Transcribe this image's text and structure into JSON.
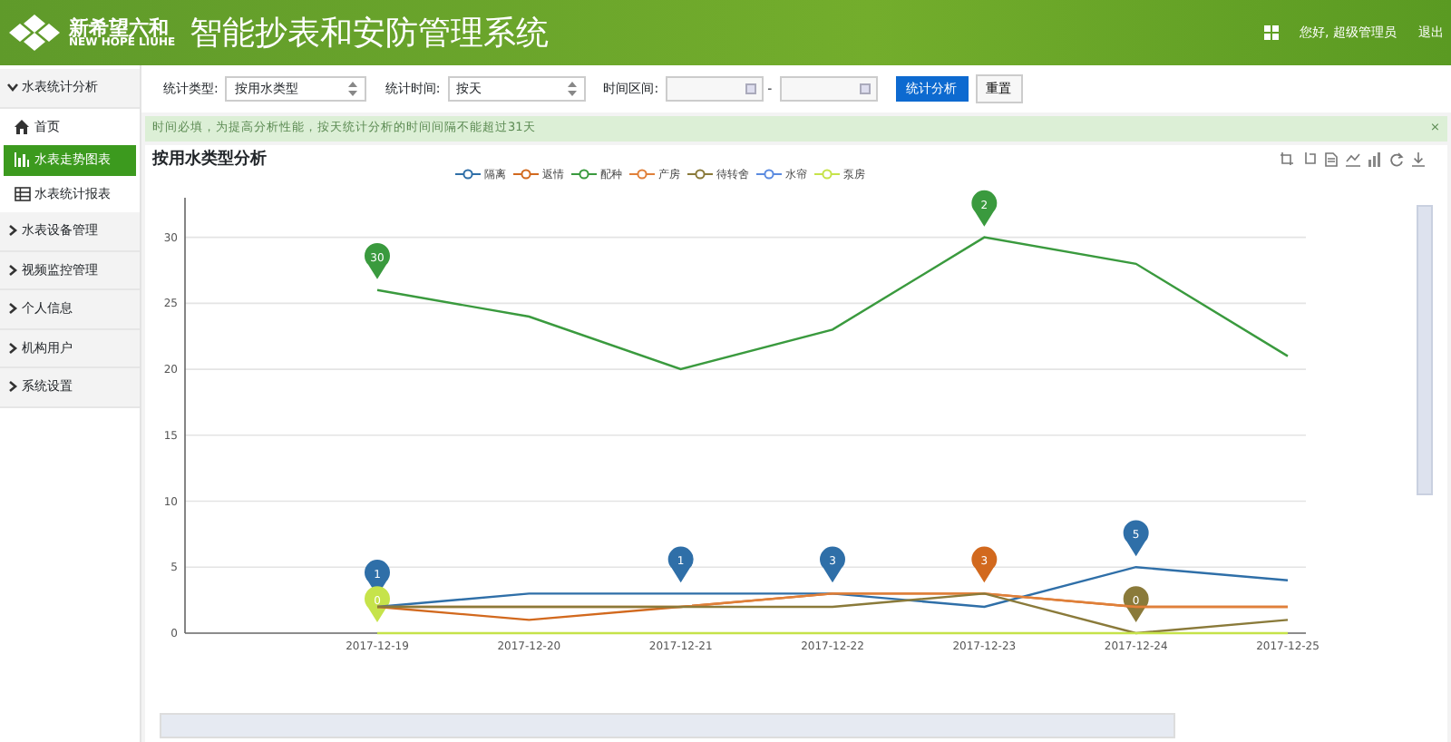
{
  "header": {
    "brand_cn": "新希望六和",
    "brand_en": "NEW HOPE LIUHE",
    "title": "智能抄表和安防管理系统",
    "greeting": "您好, 超级管理员",
    "logout": "退出"
  },
  "sidebar": {
    "items": [
      {
        "label": "水表统计分析",
        "expanded": true,
        "children": [
          {
            "label": "首页",
            "kind": "home",
            "selected": false
          },
          {
            "label": "水表走势图表",
            "kind": "chart",
            "selected": true
          },
          {
            "label": "水表统计报表",
            "kind": "table",
            "selected": false
          }
        ]
      },
      {
        "label": "水表设备管理",
        "expanded": false
      },
      {
        "label": "视频监控管理",
        "expanded": false
      },
      {
        "label": "个人信息",
        "expanded": false
      },
      {
        "label": "机构用户",
        "expanded": false
      },
      {
        "label": "系统设置",
        "expanded": false
      }
    ]
  },
  "filters": {
    "type_label": "统计类型:",
    "type_value": "按用水类型",
    "time_label": "统计时间:",
    "time_value": "按天",
    "range_label": "时间区间:",
    "range_separator": "-",
    "submit": "统计分析",
    "reset": "重置"
  },
  "alert": {
    "text": "时间必填，为提高分析性能，按天统计分析的时间间隔不能超过31天",
    "close": "×"
  },
  "chart": {
    "title": "按用水类型分析",
    "chart_data": {
      "type": "line",
      "categories": [
        "2017-12-19",
        "2017-12-20",
        "2017-12-21",
        "2017-12-22",
        "2017-12-23",
        "2017-12-24",
        "2017-12-25"
      ],
      "ylim": [
        0,
        33
      ],
      "grid": true,
      "yticks": [
        0,
        5,
        10,
        15,
        20,
        25,
        30
      ],
      "series": [
        {
          "name": "隔离",
          "color": "#2f6fa8",
          "values": [
            2,
            3,
            3,
            3,
            2,
            5,
            4
          ]
        },
        {
          "name": "返情",
          "color": "#d2691e",
          "values": [
            2,
            1,
            2,
            3,
            3,
            2,
            2
          ]
        },
        {
          "name": "配种",
          "color": "#3a9a3e",
          "values": [
            26,
            24,
            20,
            23,
            30,
            28,
            21
          ]
        },
        {
          "name": "产房",
          "color": "#e0803a",
          "values": [
            2,
            2,
            2,
            3,
            3,
            2,
            2
          ]
        },
        {
          "name": "待转舍",
          "color": "#8a7a3a",
          "values": [
            2,
            2,
            2,
            2,
            3,
            0,
            1
          ]
        },
        {
          "name": "水帘",
          "color": "#5b8be0",
          "values": [
            null,
            null,
            null,
            null,
            null,
            null,
            null
          ]
        },
        {
          "name": "泵房",
          "color": "#c6e34a",
          "values": [
            0,
            0,
            0,
            0,
            0,
            0,
            0
          ]
        }
      ],
      "annotations": [
        {
          "x": "2017-12-19",
          "y": 26,
          "text": "30"
        },
        {
          "x": "2017-12-23",
          "y": 30,
          "text": "2"
        },
        {
          "x": "2017-12-19",
          "y": 2,
          "text": "1"
        },
        {
          "x": "2017-12-21",
          "y": 3,
          "text": "1"
        },
        {
          "x": "2017-12-22",
          "y": 3,
          "text": "3"
        },
        {
          "x": "2017-12-23",
          "y": 3,
          "text": "3"
        },
        {
          "x": "2017-12-24",
          "y": 5,
          "text": "5"
        },
        {
          "x": "2017-12-24",
          "y": 0,
          "text": "0"
        },
        {
          "x": "2017-12-19",
          "y": 0,
          "text": "0"
        }
      ]
    }
  },
  "zoom_slider": {
    "level": 1
  }
}
